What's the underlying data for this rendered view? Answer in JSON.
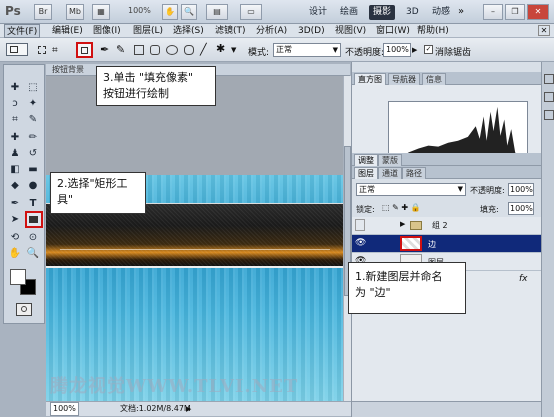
{
  "titlebar": {
    "app": "Ps",
    "zoom": "100%",
    "workspaces": [
      "设计",
      "绘画",
      "摄影",
      "3D",
      "动感"
    ],
    "active_workspace": "摄影",
    "more": "»"
  },
  "menus": [
    "文件(F)",
    "编辑(E)",
    "图像(I)",
    "图层(L)",
    "选择(S)",
    "滤镜(T)",
    "分析(A)",
    "3D(D)",
    "视图(V)",
    "窗口(W)",
    "帮助(H)"
  ],
  "options": {
    "mode_label": "模式:",
    "mode_value": "正常",
    "opacity_label": "不透明度:",
    "opacity_value": "100%",
    "antialias_label": "消除锯齿"
  },
  "document": {
    "tab": "按钮背景",
    "zoom": "100%",
    "doc_size": "文档:1.02M/8.47M"
  },
  "panels": {
    "top_tabs": [
      "直方图",
      "导航器",
      "信息"
    ],
    "mid_tabs": [
      "调整",
      "蒙版"
    ],
    "layer_tabs": [
      "图层",
      "通道",
      "路径"
    ],
    "blend_mode": "正常",
    "opacity_label": "不透明度:",
    "opacity_value": "100%",
    "lock_label": "锁定:",
    "fill_label": "填充:",
    "fill_value": "100%",
    "layers": [
      {
        "name": "组 2"
      },
      {
        "name": "边"
      },
      {
        "name": "图层"
      }
    ],
    "bottom_icon": "fx"
  },
  "callouts": {
    "step3": "3.单击 \"填充像素\"\n按钮进行绘制",
    "step2": "2.选择\"矩形工\n具\"",
    "step1": "1.新建图层并命名\n为 \"边\""
  },
  "watermark": "腾龙视觉WWW.TLVI.NET"
}
